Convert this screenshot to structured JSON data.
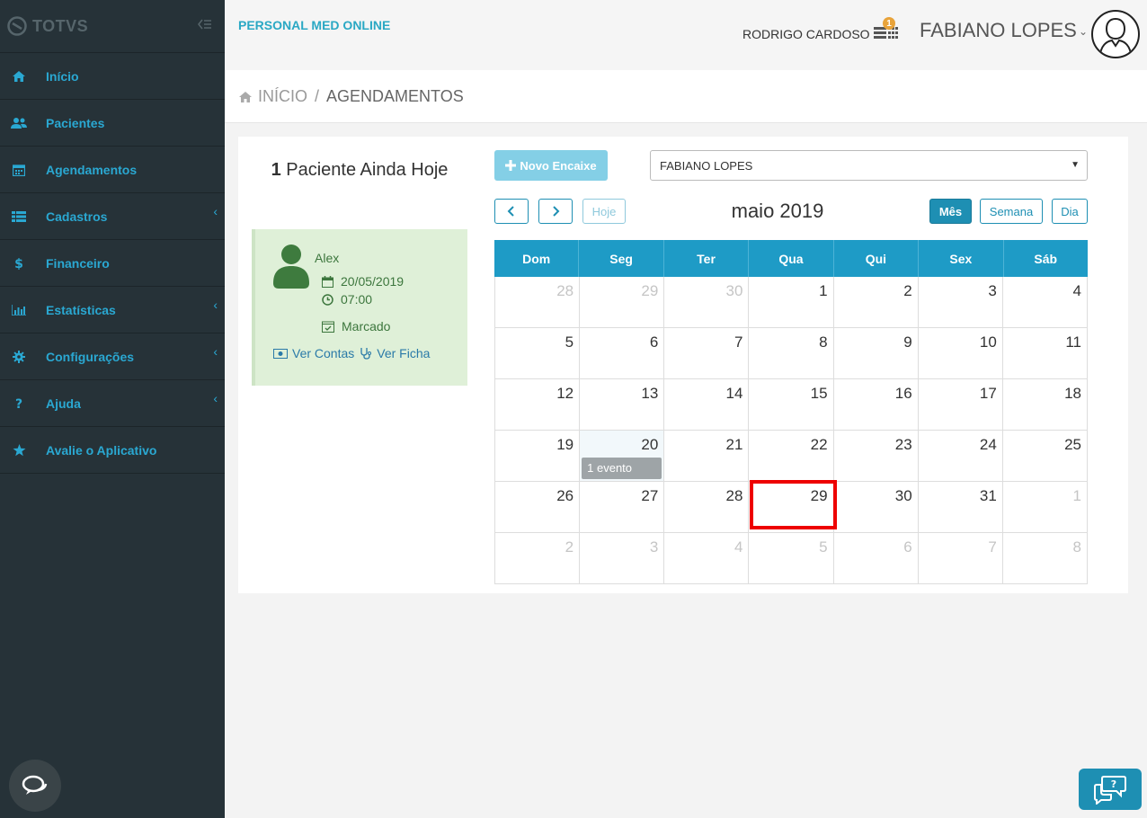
{
  "sidebar": {
    "brand": "TOTVS",
    "items": [
      {
        "label": "Início",
        "icon": "home-icon",
        "has_sub": false
      },
      {
        "label": "Pacientes",
        "icon": "users-icon",
        "has_sub": false
      },
      {
        "label": "Agendamentos",
        "icon": "calendar-icon",
        "has_sub": false
      },
      {
        "label": "Cadastros",
        "icon": "list-icon",
        "has_sub": true
      },
      {
        "label": "Financeiro",
        "icon": "dollar-icon",
        "has_sub": false
      },
      {
        "label": "Estatísticas",
        "icon": "bar-chart-icon",
        "has_sub": true
      },
      {
        "label": "Configurações",
        "icon": "gear-icon",
        "has_sub": true
      },
      {
        "label": "Ajuda",
        "icon": "question-icon",
        "has_sub": true
      },
      {
        "label": "Avalie o Aplicativo",
        "icon": "star-icon",
        "has_sub": false
      }
    ]
  },
  "topbar": {
    "app_title": "PERSONAL MED ONLINE",
    "user_small": "RODRIGO CARDOSO",
    "notification_count": "1",
    "user_big": "FABIANO LOPES"
  },
  "breadcrumb": {
    "home": "INÍCIO",
    "separator": "/",
    "current": "AGENDAMENTOS"
  },
  "today": {
    "count": "1",
    "label": "Paciente Ainda Hoje"
  },
  "patient": {
    "name": "Alex",
    "date": "20/05/2019",
    "time": "07:00",
    "status": "Marcado",
    "link_contas": "Ver Contas",
    "link_ficha": "Ver Ficha"
  },
  "toolbar": {
    "novo_encaixe": "Novo Encaixe",
    "select_value": "FABIANO LOPES"
  },
  "calendar": {
    "prev": "<",
    "next": ">",
    "today": "Hoje",
    "title": "maio 2019",
    "views": [
      "Mês",
      "Semana",
      "Dia"
    ],
    "active_view": "Mês",
    "weekdays": [
      "Dom",
      "Seg",
      "Ter",
      "Qua",
      "Qui",
      "Sex",
      "Sáb"
    ],
    "weeks": [
      [
        {
          "d": "28",
          "other": true
        },
        {
          "d": "29",
          "other": true
        },
        {
          "d": "30",
          "other": true
        },
        {
          "d": "1"
        },
        {
          "d": "2"
        },
        {
          "d": "3"
        },
        {
          "d": "4"
        }
      ],
      [
        {
          "d": "5"
        },
        {
          "d": "6"
        },
        {
          "d": "7"
        },
        {
          "d": "8"
        },
        {
          "d": "9"
        },
        {
          "d": "10"
        },
        {
          "d": "11"
        }
      ],
      [
        {
          "d": "12"
        },
        {
          "d": "13"
        },
        {
          "d": "14"
        },
        {
          "d": "15"
        },
        {
          "d": "16"
        },
        {
          "d": "17"
        },
        {
          "d": "18"
        }
      ],
      [
        {
          "d": "19"
        },
        {
          "d": "20",
          "today": true,
          "event": "1 evento"
        },
        {
          "d": "21"
        },
        {
          "d": "22"
        },
        {
          "d": "23"
        },
        {
          "d": "24"
        },
        {
          "d": "25"
        }
      ],
      [
        {
          "d": "26"
        },
        {
          "d": "27"
        },
        {
          "d": "28"
        },
        {
          "d": "29",
          "selected": true
        },
        {
          "d": "30"
        },
        {
          "d": "31"
        },
        {
          "d": "1",
          "other": true
        }
      ],
      [
        {
          "d": "2",
          "other": true
        },
        {
          "d": "3",
          "other": true
        },
        {
          "d": "4",
          "other": true
        },
        {
          "d": "5",
          "other": true
        },
        {
          "d": "6",
          "other": true
        },
        {
          "d": "7",
          "other": true
        },
        {
          "d": "8",
          "other": true
        }
      ]
    ]
  },
  "colors": {
    "accent": "#1e9bc6",
    "sidebar": "#263238",
    "success_bg": "#dff0d8",
    "highlight": "#e00000"
  }
}
